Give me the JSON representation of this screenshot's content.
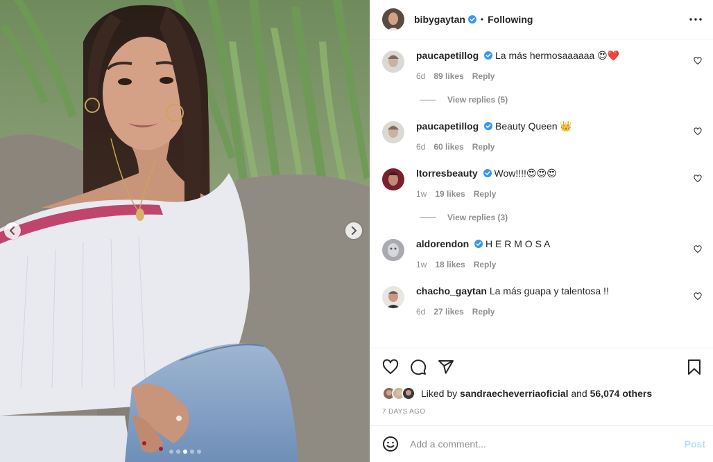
{
  "header": {
    "username": "bibygaytan",
    "separator": "•",
    "follow_status": "Following"
  },
  "comments": [
    {
      "user": "paucapetillog",
      "text": "La más hermosaaaaaa 😍❤️",
      "time": "6d",
      "likes": "89 likes",
      "reply": "Reply",
      "view_replies": "View replies (5)"
    },
    {
      "user": "paucapetillog",
      "text": "Beauty Queen 👑",
      "time": "6d",
      "likes": "60 likes",
      "reply": "Reply"
    },
    {
      "user": "ltorresbeauty",
      "text": "Wow!!!!😍😍😍",
      "time": "1w",
      "likes": "19 likes",
      "reply": "Reply",
      "view_replies": "View replies (3)"
    },
    {
      "user": "aldorendon",
      "text": "H E R M O S A",
      "time": "1w",
      "likes": "18 likes",
      "reply": "Reply"
    },
    {
      "user": "chacho_gaytan",
      "text": "La más guapa y talentosa !!",
      "time": "6d",
      "likes": "27 likes",
      "reply": "Reply"
    }
  ],
  "likes_summary": {
    "prefix": "Liked by",
    "user": "sandraecheverriaoficial",
    "conjunction": "and",
    "others": "56,074 others"
  },
  "date": "7 DAYS AGO",
  "add_comment": {
    "placeholder": "Add a comment...",
    "post_label": "Post"
  },
  "carousel": {
    "total": 5,
    "active_index": 2
  },
  "icons": {
    "more": "more-options-icon",
    "like": "heart-icon",
    "comment": "comment-icon",
    "share": "share-icon",
    "save": "bookmark-icon",
    "emoji": "emoji-icon",
    "verified": "verified-badge-icon",
    "prev": "chevron-left-icon",
    "next": "chevron-right-icon"
  },
  "colors": {
    "verified": "#3897f0",
    "post_button_disabled": "#b2dffc",
    "secondary_text": "#8e8e8e",
    "primary_text": "#262626"
  }
}
